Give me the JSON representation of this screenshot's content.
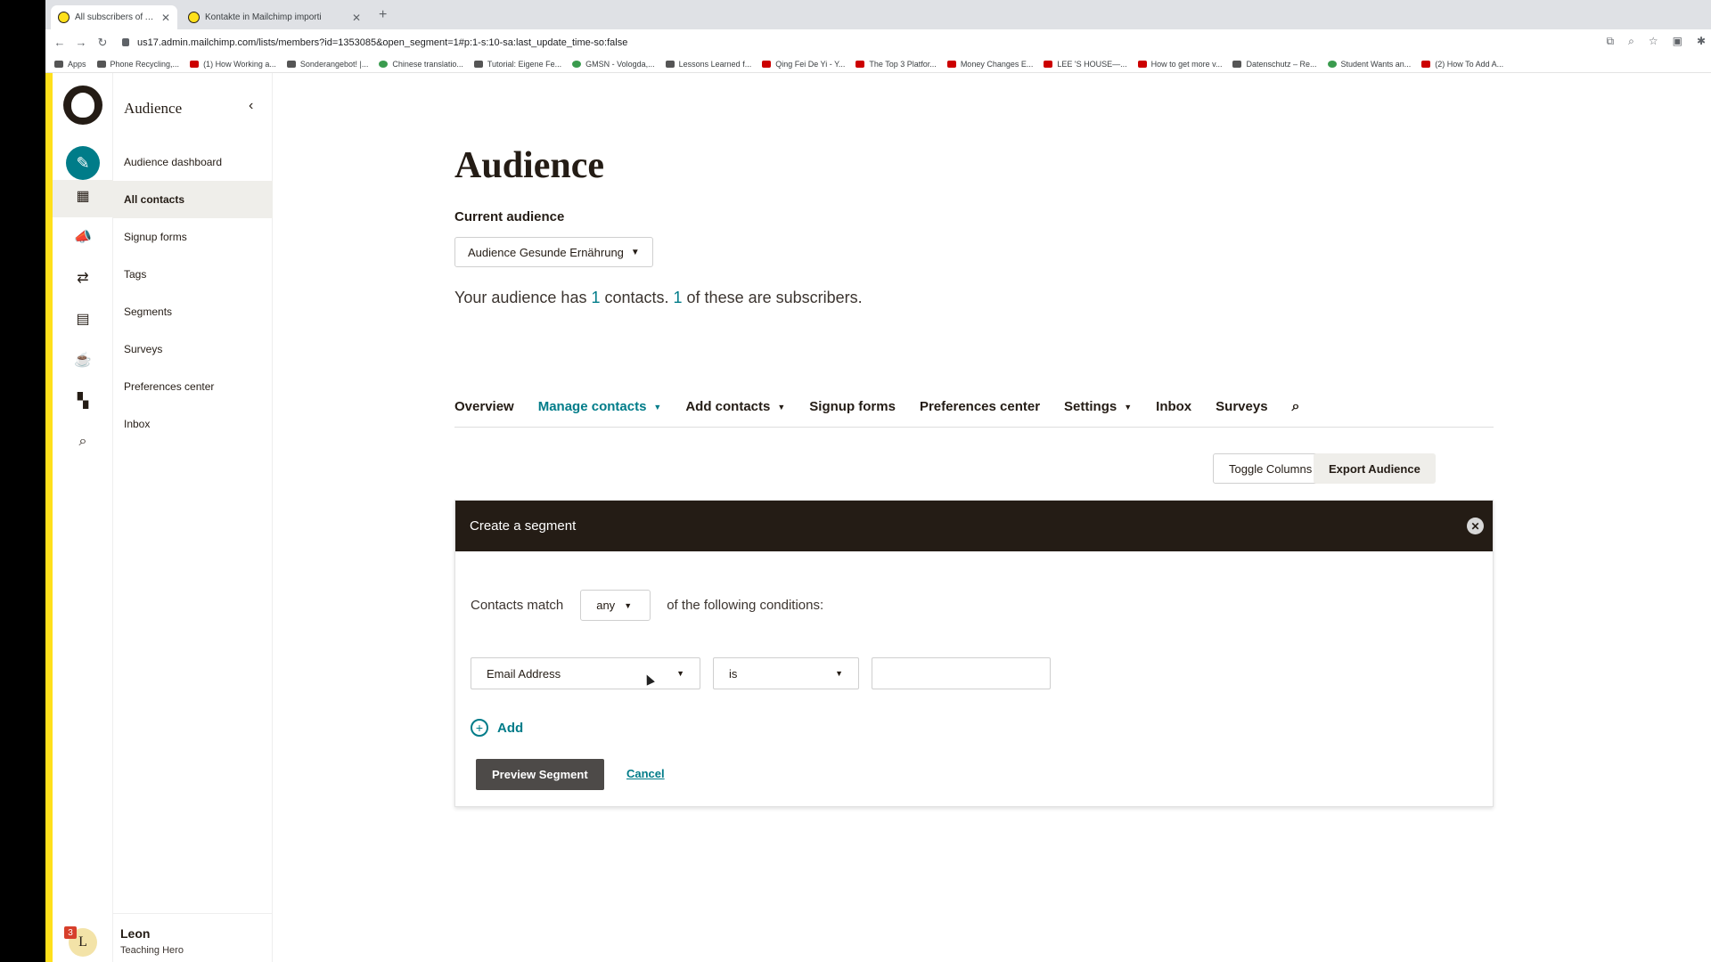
{
  "browser": {
    "tabs": [
      {
        "label": "All subscribers of Audience G",
        "active": true
      },
      {
        "label": "Kontakte in Mailchimp importi",
        "active": false
      }
    ],
    "url": "us17.admin.mailchimp.com/lists/members?id=1353085&open_segment=1#p:1-s:10-sa:last_update_time-so:false",
    "bookmarks": [
      "Apps",
      "Phone Recycling,...",
      "(1) How Working a...",
      "Sonderangebot! |...",
      "Chinese translatio...",
      "Tutorial: Eigene Fe...",
      "GMSN - Vologda,...",
      "Lessons Learned f...",
      "Qing Fei De Yi - Y...",
      "The Top 3 Platfor...",
      "Money Changes E...",
      "LEE 'S HOUSE—...",
      "How to get more v...",
      "Datenschutz – Re...",
      "Student Wants an...",
      "(2) How To Add A..."
    ]
  },
  "sidebar": {
    "title": "Audience",
    "items": [
      {
        "label": "Audience dashboard",
        "active": false
      },
      {
        "label": "All contacts",
        "active": true
      },
      {
        "label": "Signup forms",
        "active": false
      },
      {
        "label": "Tags",
        "active": false
      },
      {
        "label": "Segments",
        "active": false
      },
      {
        "label": "Surveys",
        "active": false
      },
      {
        "label": "Preferences center",
        "active": false
      },
      {
        "label": "Inbox",
        "active": false
      }
    ],
    "user": {
      "name": "Leon",
      "role": "Teaching Hero",
      "initial": "L",
      "notifications": "3"
    }
  },
  "main": {
    "title": "Audience",
    "current_audience_label": "Current audience",
    "audience_name": "Audience Gesunde Ernährung",
    "summary": {
      "prefix": "Your audience has ",
      "contacts": "1",
      "middle": " contacts. ",
      "subscribers": "1",
      "suffix": " of these are subscribers."
    },
    "tabs": [
      {
        "label": "Overview",
        "dropdown": false,
        "active": false
      },
      {
        "label": "Manage contacts",
        "dropdown": true,
        "active": true
      },
      {
        "label": "Add contacts",
        "dropdown": true,
        "active": false
      },
      {
        "label": "Signup forms",
        "dropdown": false,
        "active": false
      },
      {
        "label": "Preferences center",
        "dropdown": false,
        "active": false
      },
      {
        "label": "Settings",
        "dropdown": true,
        "active": false
      },
      {
        "label": "Inbox",
        "dropdown": false,
        "active": false
      },
      {
        "label": "Surveys",
        "dropdown": false,
        "active": false
      }
    ],
    "toggle_columns": "Toggle Columns",
    "export_audience": "Export Audience"
  },
  "segment": {
    "header": "Create a segment",
    "match_prefix": "Contacts match",
    "match_value": "any",
    "match_suffix": "of the following conditions:",
    "field": "Email Address",
    "operator": "is",
    "value": "",
    "add_label": "Add",
    "preview_button": "Preview Segment",
    "cancel_link": "Cancel"
  },
  "colors": {
    "accent_teal": "#007c89",
    "brand_yellow": "#ffe01b",
    "dark": "#241c15"
  }
}
